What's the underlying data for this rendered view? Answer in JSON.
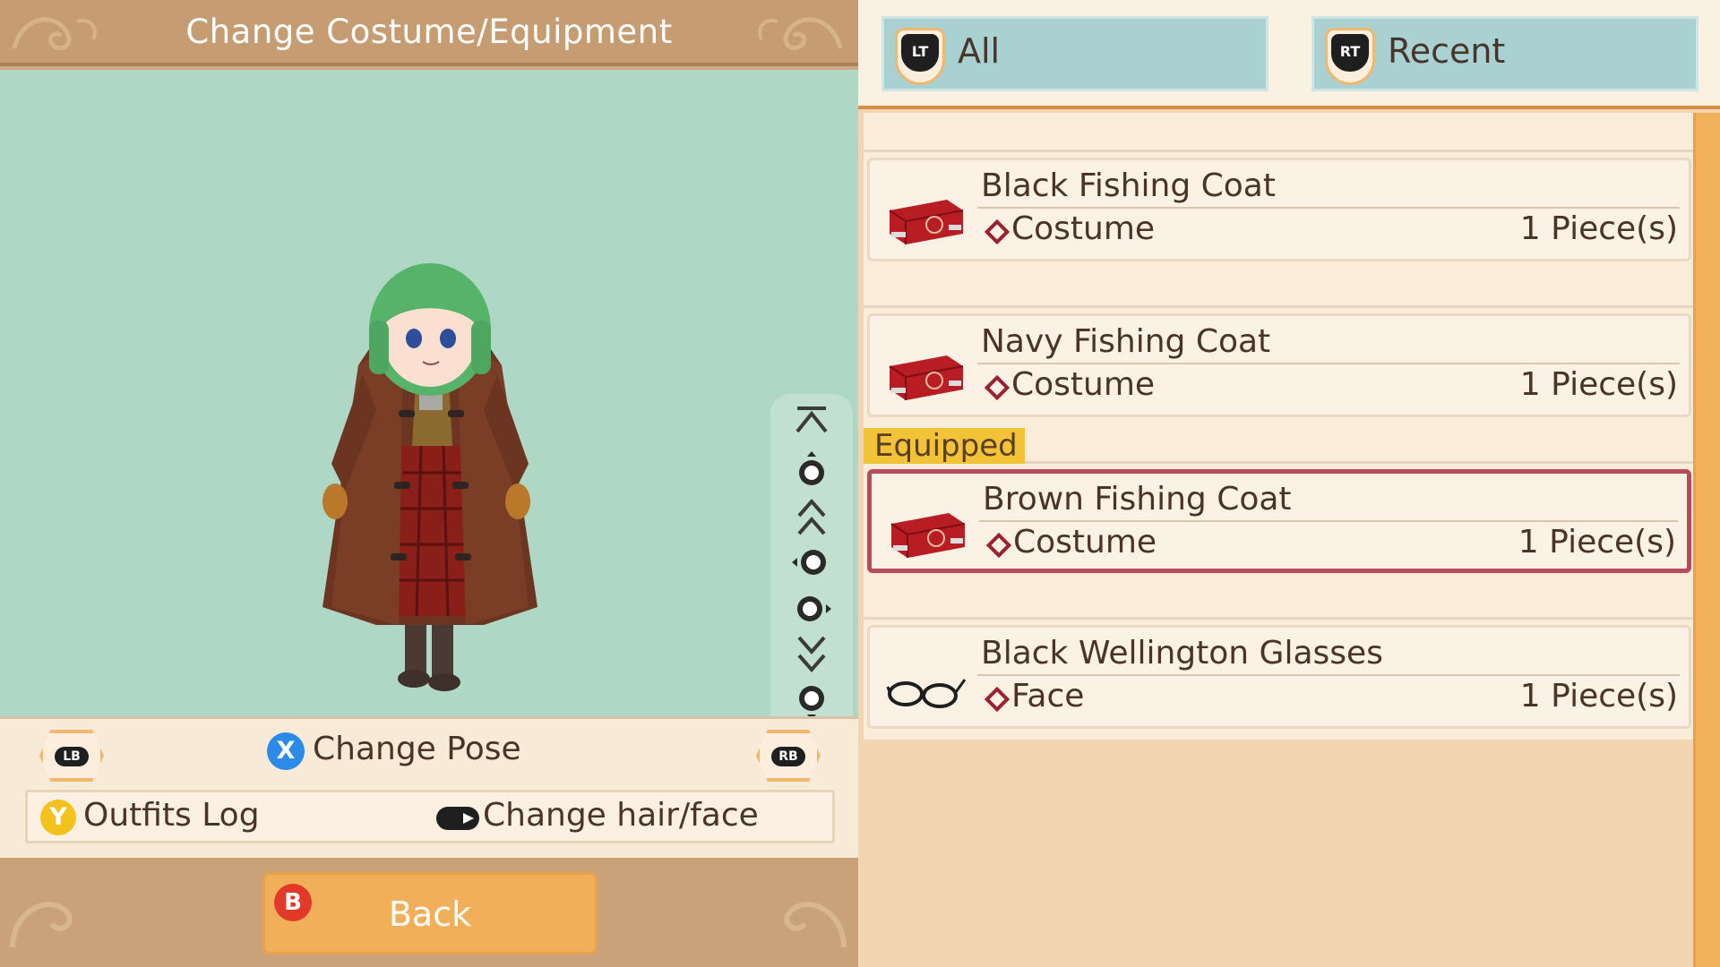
{
  "title": "Change Costume/Equipment",
  "pose_controls": [
    "top-arrow-icon",
    "rstick-up-icon",
    "double-up-icon",
    "rstick-left-icon",
    "rstick-right-icon",
    "double-down-icon",
    "rstick-down-icon",
    "bottom-arrow-icon"
  ],
  "controls": {
    "lb": "LB",
    "rb": "RB",
    "x_button": "X",
    "change_pose": "Change Pose",
    "y_button": "Y",
    "outfits_log": "Outfits Log",
    "change_hair_face": "Change hair/face",
    "b_button": "B",
    "back": "Back"
  },
  "tabs": [
    {
      "key": "LT",
      "label": "All"
    },
    {
      "key": "RT",
      "label": "Recent"
    }
  ],
  "equipped_label": "Equipped",
  "items": [
    {
      "name": "Black Fishing Coat",
      "category": "Costume",
      "quantity": "1 Piece(s)",
      "icon": "costume-case-icon",
      "equipped": false
    },
    {
      "name": "Navy Fishing Coat",
      "category": "Costume",
      "quantity": "1 Piece(s)",
      "icon": "costume-case-icon",
      "equipped": false
    },
    {
      "name": "Brown Fishing Coat",
      "category": "Costume",
      "quantity": "1 Piece(s)",
      "icon": "costume-case-icon",
      "equipped": true
    },
    {
      "name": "Black Wellington Glasses",
      "category": "Face",
      "quantity": "1 Piece(s)",
      "icon": "glasses-icon",
      "equipped": false
    }
  ],
  "colors": {
    "viewport": "#aed7c5",
    "tab": "#a9d1d2",
    "selected_border": "#b84a5e",
    "equipped_tag": "#f2c338",
    "back_button": "#f2af5a"
  }
}
